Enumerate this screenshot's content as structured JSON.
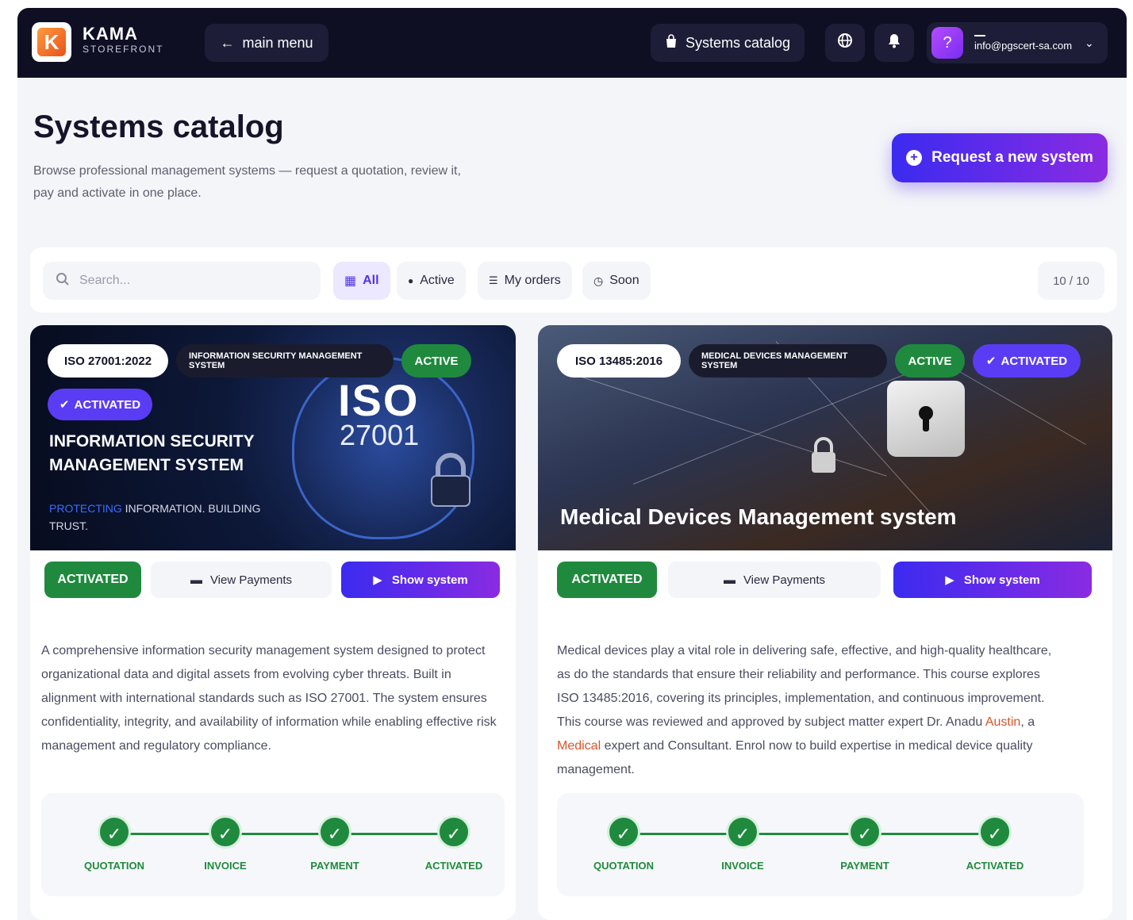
{
  "brand": {
    "name": "KAMA",
    "sub": "STOREFRONT",
    "logo_letter": "K"
  },
  "nav": {
    "main_menu": "main menu",
    "systems_catalog": "Systems catalog",
    "user_email": "info@pgscert-sa.com",
    "avatar": "?"
  },
  "header": {
    "title": "Systems catalog",
    "description": "Browse professional management systems — request a quotation, review it, pay and activate in one place.",
    "request_button": "Request a new system"
  },
  "filters": {
    "search_placeholder": "Search...",
    "chips": [
      "All",
      "Active",
      "My orders",
      "Soon"
    ],
    "count": "10 / 10"
  },
  "cards": [
    {
      "code": "ISO 27001:2022",
      "system_name": "INFORMATION SECURITY MANAGEMENT SYSTEM",
      "status": "ACTIVE",
      "activated": "ACTIVATED",
      "hero_iso": "ISO",
      "hero_iso_num": "27001",
      "hero_title": "INFORMATION SECURITY MANAGEMENT SYSTEM",
      "hero_tag_hl": "PROTECTING",
      "hero_tag_rest": " INFORMATION. BUILDING TRUST.",
      "action_status": "ACTIVATED",
      "action_payments": "View Payments",
      "action_show": "Show system",
      "description": "A comprehensive information security management system designed to protect organizational data and digital assets from evolving cyber threats. Built in alignment with international standards such as ISO 27001. The system ensures confidentiality, integrity, and availability of information while enabling effective risk management and regulatory compliance.",
      "steps": [
        "QUOTATION",
        "INVOICE",
        "PAYMENT",
        "ACTIVATED"
      ]
    },
    {
      "code": "ISO 13485:2016",
      "system_name": "MEDICAL DEVICES MANAGEMENT SYSTEM",
      "status": "ACTIVE",
      "activated": "ACTIVATED",
      "hero_title": "Medical Devices Management system",
      "action_status": "ACTIVATED",
      "action_payments": "View Payments",
      "action_show": "Show system",
      "description_pre": "Medical devices play a vital role in delivering safe, effective, and high-quality healthcare, as do the standards that ensure their reliability and performance. This course explores ISO 13485:2016, covering its principles, implementation, and continuous improvement. This course was reviewed and approved by subject matter expert Dr. Anadu ",
      "description_hl1": "Austin",
      "description_mid": ", a ",
      "description_hl2": "Medical",
      "description_post": " expert and Consultant. Enrol now to build expertise in medical device quality management.",
      "steps": [
        "QUOTATION",
        "INVOICE",
        "PAYMENT",
        "ACTIVATED"
      ]
    }
  ],
  "colors": {
    "topbar": "#0f0f24",
    "accent": "#5432e8",
    "success": "#1f8a3d"
  }
}
